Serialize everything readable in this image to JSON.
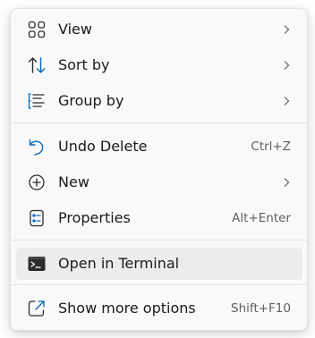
{
  "menu": {
    "items": [
      {
        "label": "View",
        "icon": "grid-view-icon",
        "submenu": true
      },
      {
        "label": "Sort by",
        "icon": "sort-arrows-icon",
        "submenu": true
      },
      {
        "label": "Group by",
        "icon": "group-list-icon",
        "submenu": true
      },
      {
        "label": "Undo Delete",
        "icon": "undo-icon",
        "shortcut": "Ctrl+Z"
      },
      {
        "label": "New",
        "icon": "add-circle-icon",
        "submenu": true
      },
      {
        "label": "Properties",
        "icon": "properties-icon",
        "shortcut": "Alt+Enter"
      },
      {
        "label": "Open in Terminal",
        "icon": "terminal-icon",
        "highlighted": true
      },
      {
        "label": "Show more options",
        "icon": "open-external-icon",
        "shortcut": "Shift+F10"
      }
    ]
  },
  "colors": {
    "accent": "#0067c0",
    "menu_background": "#f9f9f9",
    "hover_background": "#ececec",
    "shortcut_text": "#5f5f5f"
  }
}
